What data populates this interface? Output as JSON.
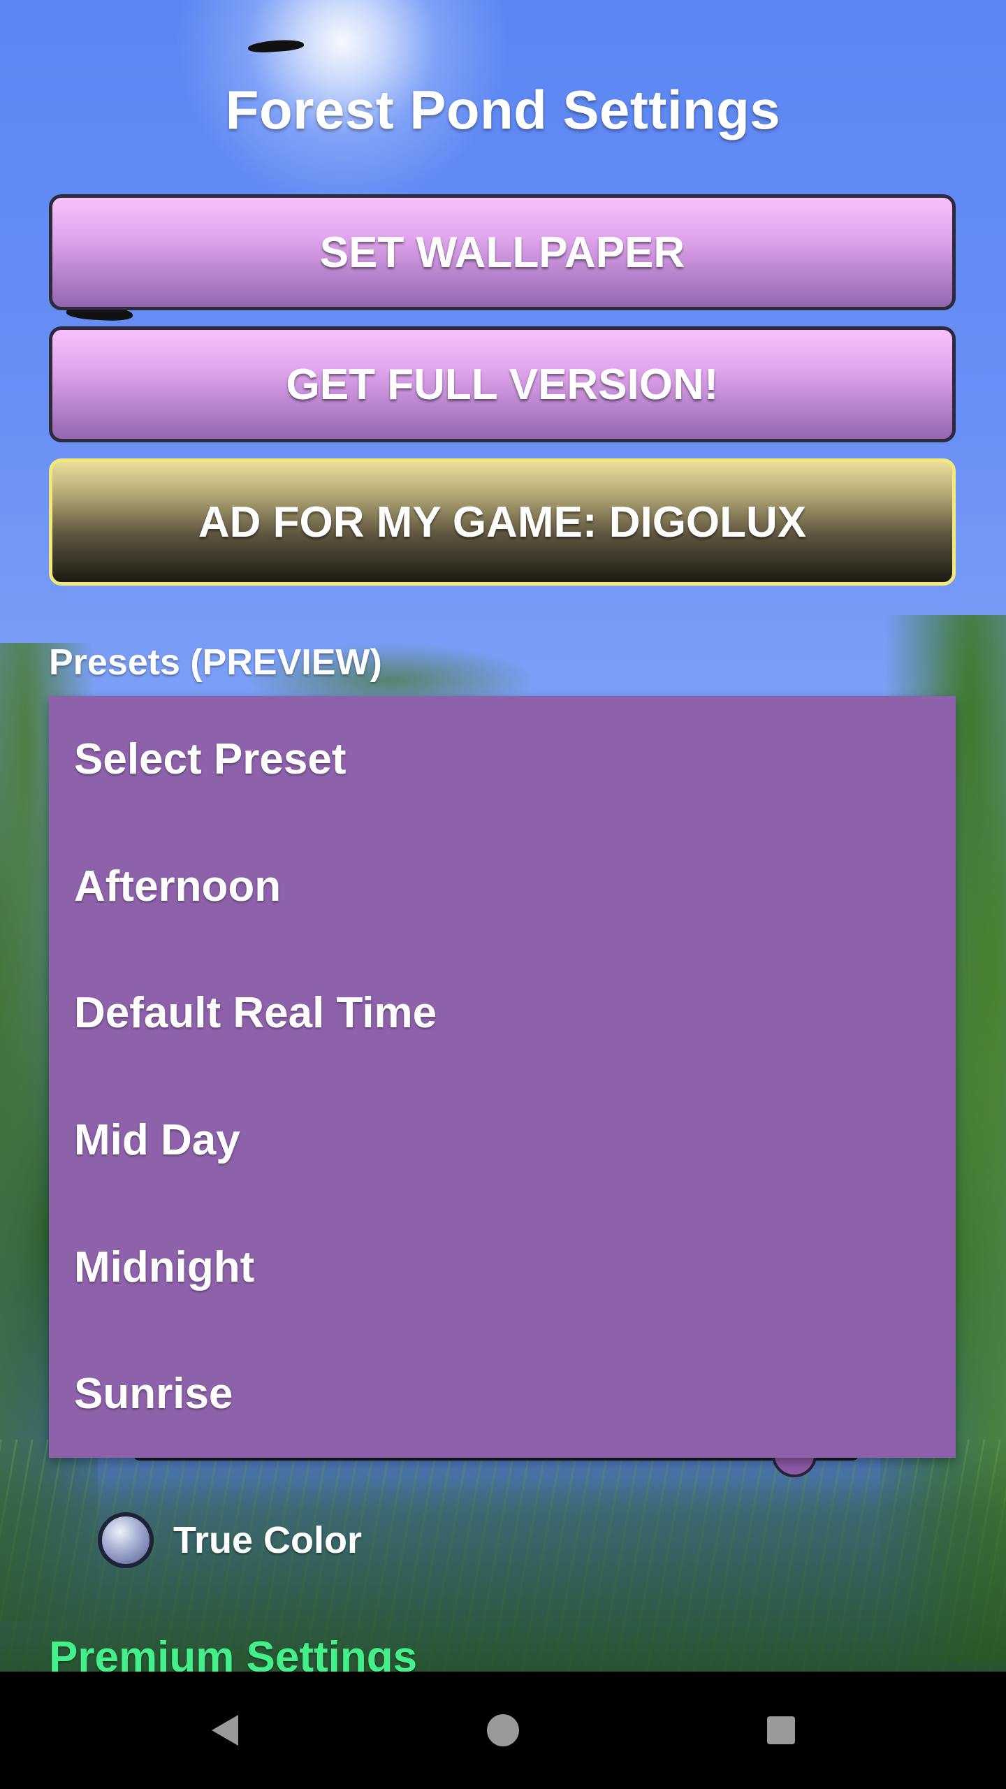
{
  "header": {
    "title": "Forest Pond Settings"
  },
  "buttons": {
    "set_wallpaper": "SET WALLPAPER",
    "get_full_version": "GET FULL VERSION!",
    "ad_game": "AD FOR MY GAME: DIGOLUX"
  },
  "presets": {
    "label": "Presets (PREVIEW)",
    "options": [
      "Select Preset",
      "Afternoon",
      "Default Real Time",
      "Mid Day",
      "Midnight",
      "Sunrise"
    ]
  },
  "options": {
    "true_color_label": "True Color"
  },
  "premium": {
    "heading": "Premium Settings"
  },
  "colors": {
    "dropdown_bg": "#8e62aa",
    "button_purple": "#b27fc8",
    "ad_border": "#f3e87a",
    "premium_text": "#44f08a"
  },
  "navbar": {
    "icons": [
      "back-icon",
      "home-icon",
      "recents-icon"
    ]
  }
}
